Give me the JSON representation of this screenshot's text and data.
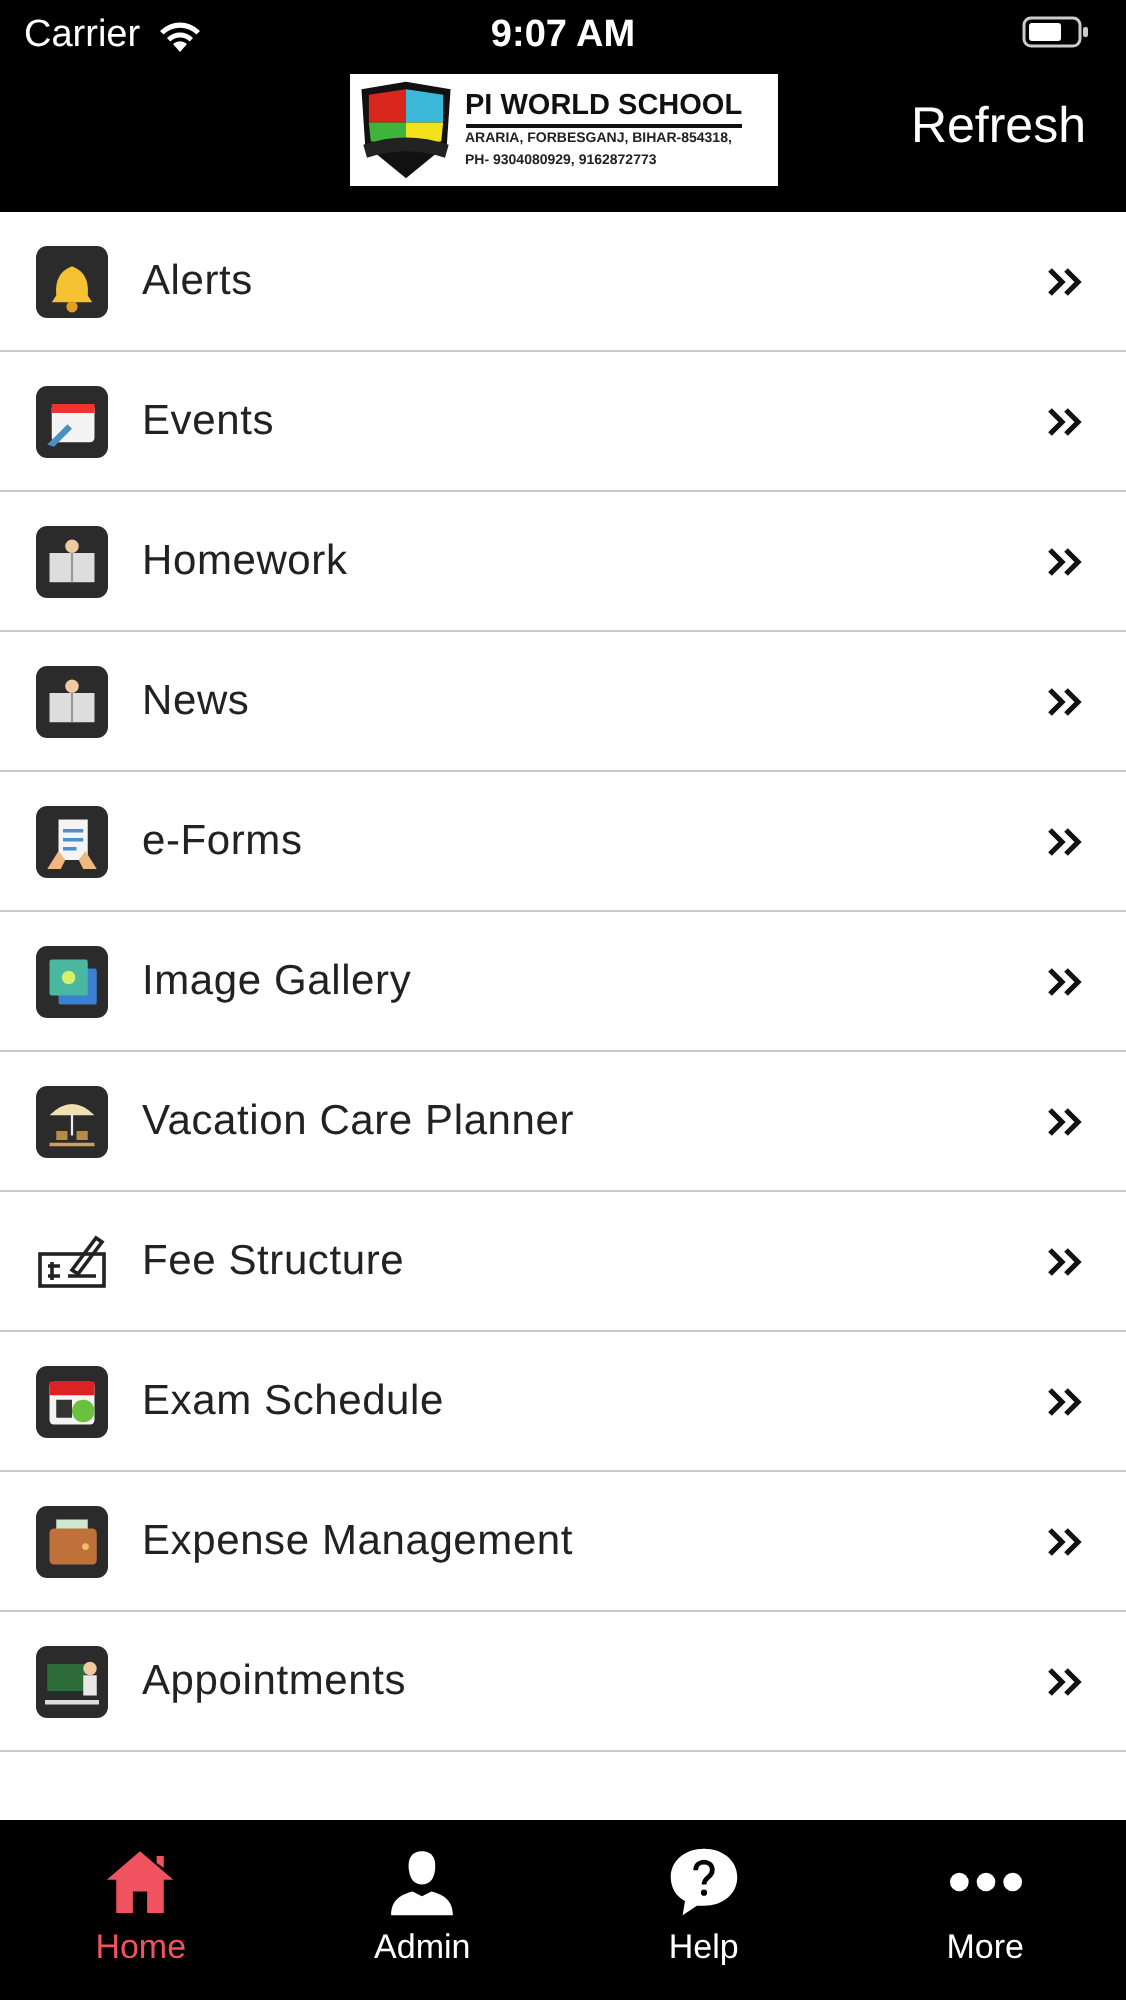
{
  "status_bar": {
    "carrier": "Carrier",
    "time": "9:07 AM"
  },
  "nav_bar": {
    "logo": {
      "title": "PI WORLD SCHOOL",
      "address": "ARARIA, FORBESGANJ, BIHAR-854318,",
      "phone": "PH- 9304080929, 9162872773"
    },
    "action": "Refresh"
  },
  "menu": [
    {
      "label": "Alerts"
    },
    {
      "label": "Events"
    },
    {
      "label": "Homework"
    },
    {
      "label": "News"
    },
    {
      "label": "e-Forms"
    },
    {
      "label": "Image Gallery"
    },
    {
      "label": "Vacation Care Planner"
    },
    {
      "label": "Fee Structure"
    },
    {
      "label": "Exam Schedule"
    },
    {
      "label": "Expense Management"
    },
    {
      "label": "Appointments"
    }
  ],
  "tab_bar": [
    {
      "label": "Home",
      "selected": true
    },
    {
      "label": "Admin",
      "selected": false
    },
    {
      "label": "Help",
      "selected": false
    },
    {
      "label": "More",
      "selected": false
    }
  ]
}
